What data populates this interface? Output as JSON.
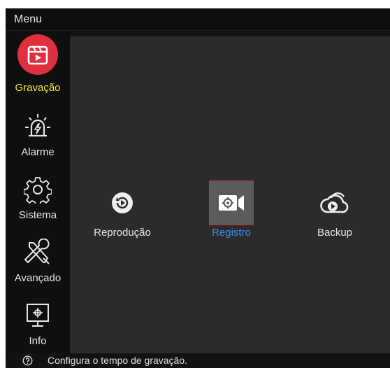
{
  "titlebar": {
    "title": "Menu"
  },
  "sidebar": {
    "items": [
      {
        "label": "Gravação",
        "icon": "record-clapper-icon",
        "active": true
      },
      {
        "label": "Alarme",
        "icon": "alarm-siren-icon",
        "active": false
      },
      {
        "label": "Sistema",
        "icon": "gear-icon",
        "active": false
      },
      {
        "label": "Avançado",
        "icon": "tools-icon",
        "active": false
      },
      {
        "label": "Info",
        "icon": "monitor-info-icon",
        "active": false
      }
    ]
  },
  "content": {
    "tiles": [
      {
        "label": "Reprodução",
        "icon": "playback-icon",
        "selected": false
      },
      {
        "label": "Registro",
        "icon": "camera-settings-icon",
        "selected": true
      },
      {
        "label": "Backup",
        "icon": "cloud-play-icon",
        "selected": false
      }
    ]
  },
  "status": {
    "icon": "help-circle-icon",
    "text": "Configura o tempo de gravação."
  },
  "colors": {
    "active_label": "#f2ea3c",
    "selected_label": "#3c8ce0",
    "accent_red": "#e03040"
  }
}
